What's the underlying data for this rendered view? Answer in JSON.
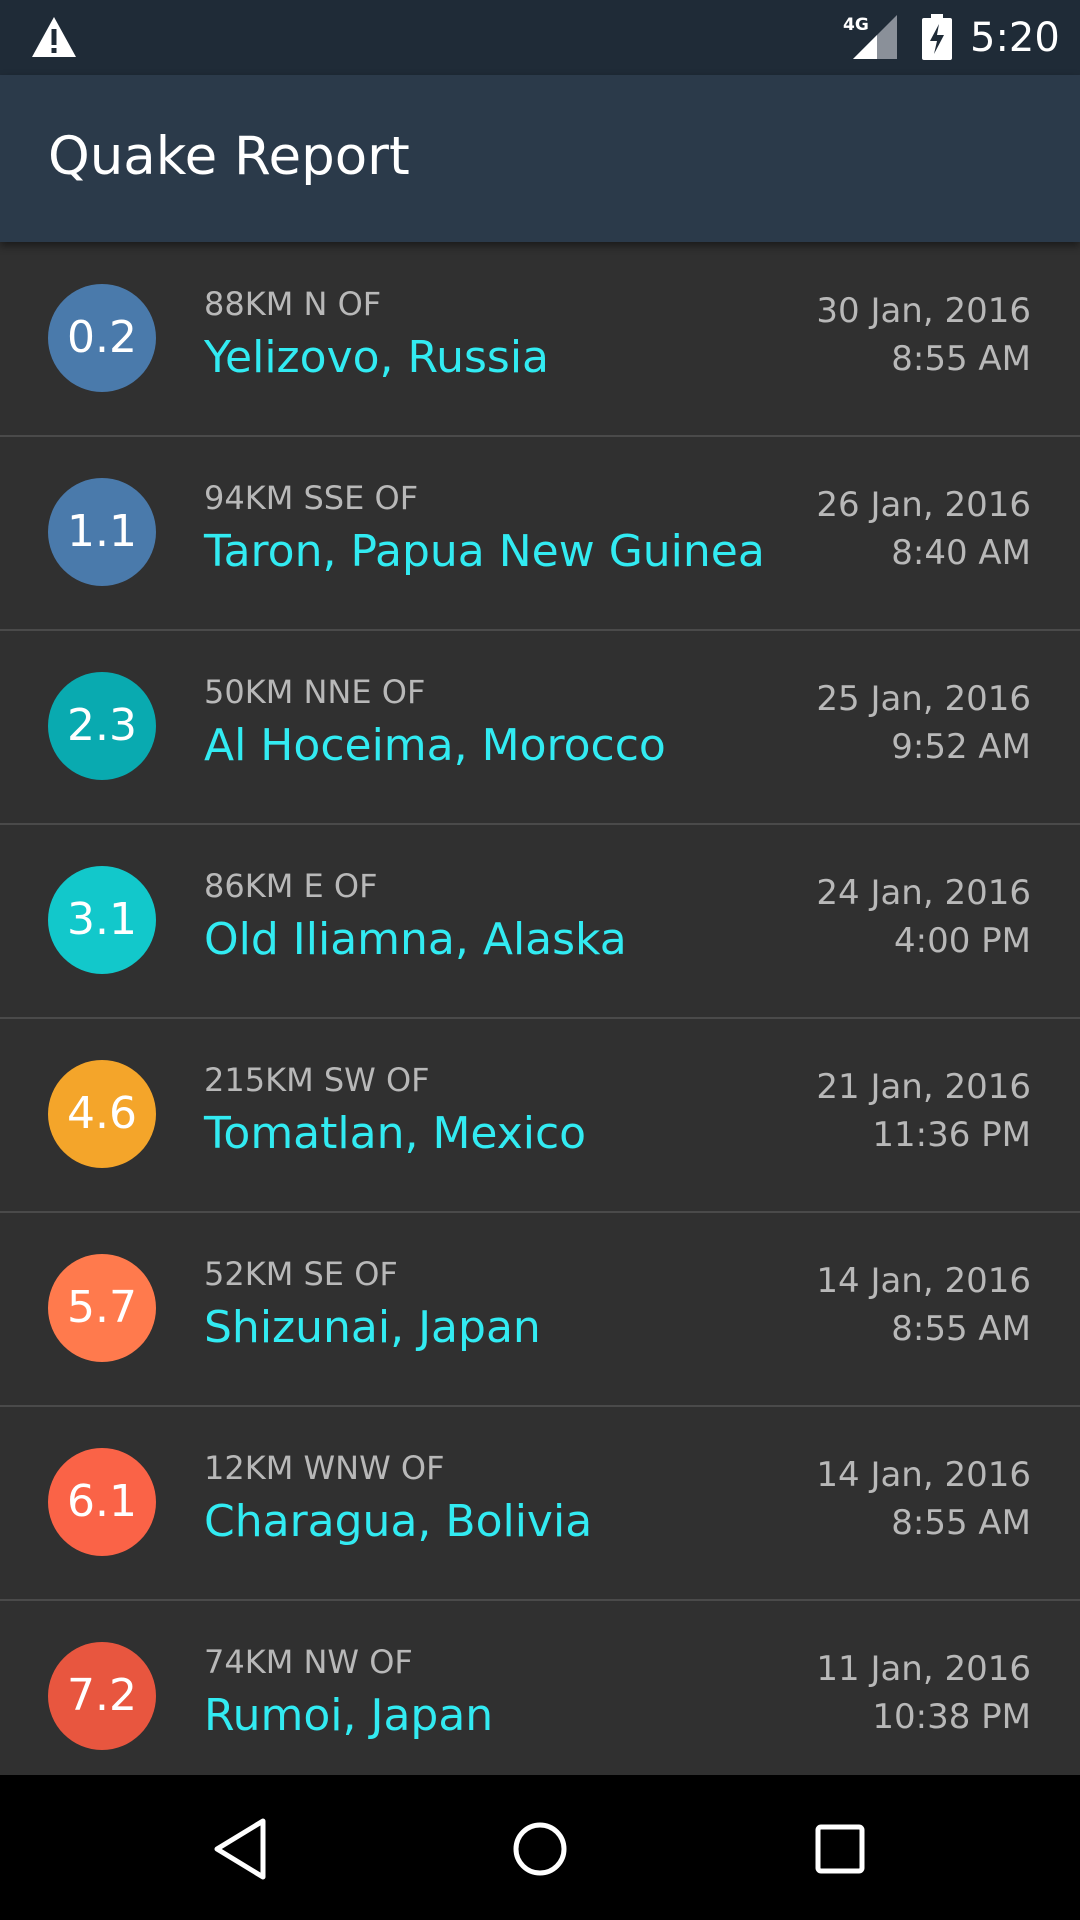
{
  "status_bar": {
    "time": "5:20",
    "network_label": "4G",
    "icons": [
      "warning-icon",
      "signal-icon",
      "battery-charging-icon"
    ]
  },
  "app_bar": {
    "title": "Quake Report"
  },
  "earthquakes": [
    {
      "magnitude": "0.2",
      "offset": "88KM N OF",
      "place": "Yelizovo, Russia",
      "date": "30 Jan, 2016",
      "time": "8:55 AM",
      "color": "#4a7aab"
    },
    {
      "magnitude": "1.1",
      "offset": "94KM SSE OF",
      "place": "Taron, Papua New Guinea",
      "date": "26 Jan, 2016",
      "time": "8:40 AM",
      "color": "#4a7aab"
    },
    {
      "magnitude": "2.3",
      "offset": "50KM NNE OF",
      "place": "Al Hoceima, Morocco",
      "date": "25 Jan, 2016",
      "time": "9:52 AM",
      "color": "#09aab0"
    },
    {
      "magnitude": "3.1",
      "offset": "86KM E OF",
      "place": "Old Iliamna, Alaska",
      "date": "24 Jan, 2016",
      "time": "4:00 PM",
      "color": "#12c8cb"
    },
    {
      "magnitude": "4.6",
      "offset": "215KM SW OF",
      "place": "Tomatlan, Mexico",
      "date": "21 Jan, 2016",
      "time": "11:36 PM",
      "color": "#f4a52a"
    },
    {
      "magnitude": "5.7",
      "offset": "52KM SE OF",
      "place": "Shizunai, Japan",
      "date": "14 Jan, 2016",
      "time": "8:55 AM",
      "color": "#ff7a4d"
    },
    {
      "magnitude": "6.1",
      "offset": "12KM WNW OF",
      "place": "Charagua, Bolivia",
      "date": "14 Jan, 2016",
      "time": "8:55 AM",
      "color": "#fa6347"
    },
    {
      "magnitude": "7.2",
      "offset": "74KM NW OF",
      "place": "Rumoi, Japan",
      "date": "11 Jan, 2016",
      "time": "10:38 PM",
      "color": "#e8563f"
    }
  ],
  "nav_bar": {
    "buttons": [
      "back-icon",
      "home-icon",
      "recents-icon"
    ]
  },
  "colors": {
    "status_bar_bg": "#1f2b37",
    "app_bar_bg": "#2b3a4a",
    "list_bg": "#303030",
    "place_text": "#32ebf2",
    "secondary_text": "#b8b8b8",
    "divider": "#4a4a4a"
  }
}
